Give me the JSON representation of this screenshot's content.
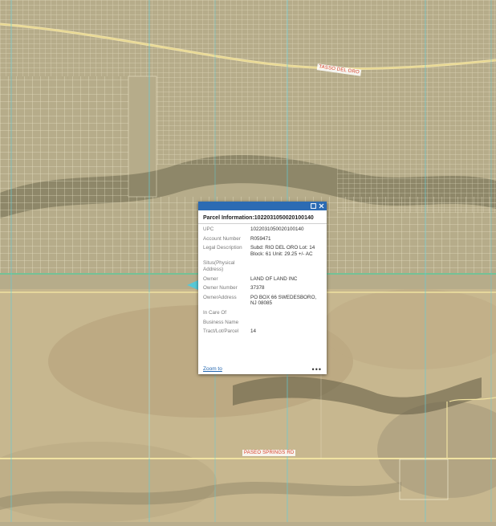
{
  "map": {
    "road_labels": {
      "north": "TASSO DEL ORO",
      "south": "PASEO SPRINGS RD"
    }
  },
  "popup": {
    "title": "Parcel Information:102203105002010014 0",
    "title_full": "Parcel Information:1022031050020100140",
    "fields": [
      {
        "label": "UPC",
        "value": "1022031050020100140"
      },
      {
        "label": "Account Number",
        "value": "R059471"
      },
      {
        "label": "Legal Description",
        "value": "Subd: RIO DEL ORO Lot: 14 Block: 61 Unit: 29.25 +/- AC"
      },
      {
        "label": "Situs(Physical Address)",
        "value": ""
      },
      {
        "label": "Owner",
        "value": "LAND OF LAND INC"
      },
      {
        "label": "Owner Number",
        "value": "37378"
      },
      {
        "label": "OwnerAddress",
        "value": "PO BOX 66 SWEDESBORO, NJ 08085"
      },
      {
        "label": "In Care Of",
        "value": ""
      },
      {
        "label": "Business Name",
        "value": ""
      },
      {
        "label": "Tract/Lot/Parcel",
        "value": "14"
      }
    ],
    "zoom_label": "Zoom to",
    "more_label": "•••",
    "header_color": "#2c6bb3"
  },
  "icons": [
    "maximize-icon",
    "close-icon",
    "more-icon"
  ]
}
